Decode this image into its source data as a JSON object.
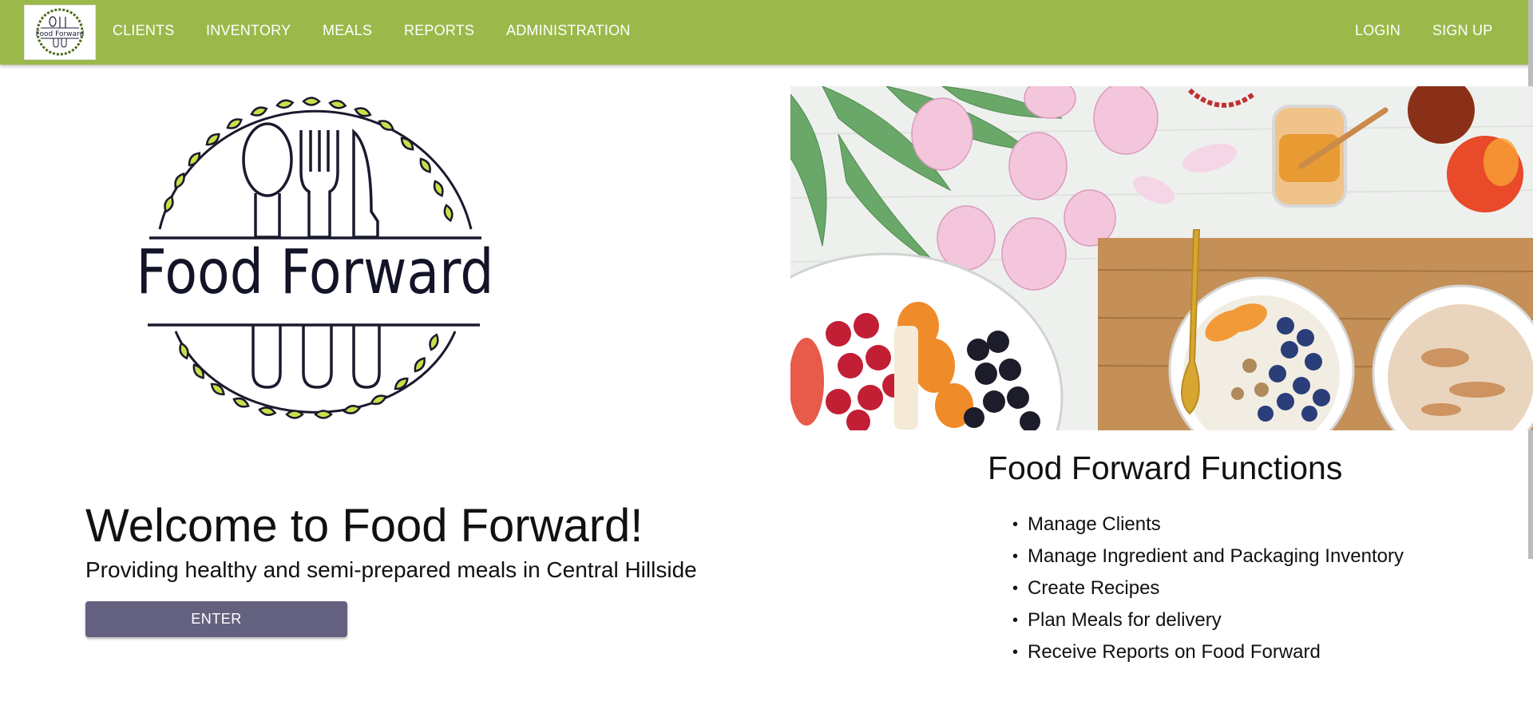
{
  "nav": {
    "logo_text": "Food Forward",
    "items": [
      {
        "label": "CLIENTS"
      },
      {
        "label": "INVENTORY"
      },
      {
        "label": "MEALS"
      },
      {
        "label": "REPORTS"
      },
      {
        "label": "ADMINISTRATION"
      }
    ],
    "login_label": "LOGIN",
    "signup_label": "SIGN UP"
  },
  "logo": {
    "text": "Food Forward",
    "icon": "utensils-wreath-logo"
  },
  "hero_image": {
    "icon": "food-flatlay-photo"
  },
  "welcome": {
    "title": "Welcome to Food Forward!",
    "subtitle": "Providing healthy and semi-prepared meals in Central Hillside",
    "enter_label": "ENTER"
  },
  "functions": {
    "title": "Food Forward Functions",
    "items": [
      "Manage Clients",
      "Manage Ingredient and Packaging Inventory",
      "Create Recipes",
      "Plan Meals for delivery",
      "Receive Reports on Food Forward"
    ]
  },
  "colors": {
    "navbar": "#9bb94b",
    "button": "#646180",
    "leaf": "#c8e04a"
  }
}
